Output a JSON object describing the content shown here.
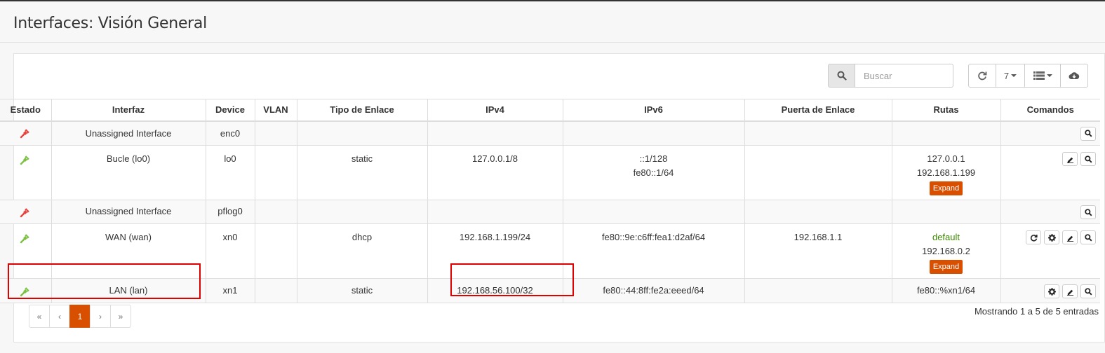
{
  "page": {
    "title": "Interfaces: Visión General"
  },
  "toolbar": {
    "search_placeholder": "Buscar",
    "refresh_icon": "refresh-icon",
    "page_size": "7",
    "columns_icon": "list-icon",
    "download_icon": "cloud-download-icon"
  },
  "table": {
    "headers": [
      "Estado",
      "Interfaz",
      "Device",
      "VLAN",
      "Tipo de Enlace",
      "IPv4",
      "IPv6",
      "Puerta de Enlace",
      "Rutas",
      "Comandos"
    ],
    "rows": [
      {
        "status": "down",
        "interface": "Unassigned Interface",
        "device": "enc0",
        "vlan": "",
        "link_type": "",
        "ipv4": "",
        "ipv6": [
          "",
          ""
        ],
        "gateway": "",
        "routes": [
          "",
          ""
        ],
        "expand": "",
        "commands": [
          "search"
        ]
      },
      {
        "status": "up",
        "interface": "Bucle (lo0)",
        "device": "lo0",
        "vlan": "",
        "link_type": "static",
        "ipv4": "127.0.0.1/8",
        "ipv6": [
          "::1/128",
          "fe80::1/64"
        ],
        "gateway": "",
        "routes": [
          "127.0.0.1",
          "192.168.1.199"
        ],
        "expand": "Expand",
        "commands": [
          "edit",
          "search"
        ]
      },
      {
        "status": "down",
        "interface": "Unassigned Interface",
        "device": "pflog0",
        "vlan": "",
        "link_type": "",
        "ipv4": "",
        "ipv6": [
          "",
          ""
        ],
        "gateway": "",
        "routes": [
          "",
          ""
        ],
        "expand": "",
        "commands": [
          "search"
        ]
      },
      {
        "status": "up",
        "interface": "WAN (wan)",
        "device": "xn0",
        "vlan": "",
        "link_type": "dhcp",
        "ipv4": "192.168.1.199/24",
        "ipv6": [
          "fe80::9e:c6ff:fea1:d2af/64",
          ""
        ],
        "gateway": "192.168.1.1",
        "routes": [
          "default",
          "192.168.0.2"
        ],
        "expand": "Expand",
        "commands": [
          "reload",
          "settings",
          "edit",
          "search"
        ]
      },
      {
        "status": "up",
        "interface": "LAN (lan)",
        "device": "xn1",
        "vlan": "",
        "link_type": "static",
        "ipv4": "192.168.56.100/32",
        "ipv6": [
          "fe80::44:8ff:fe2a:eeed/64",
          ""
        ],
        "gateway": "",
        "routes": [
          "fe80::%xn1/64",
          ""
        ],
        "expand": "",
        "commands": [
          "settings",
          "edit",
          "search"
        ]
      }
    ]
  },
  "pagination": {
    "first": "«",
    "prev": "‹",
    "current": "1",
    "next": "›",
    "last": "»"
  },
  "footer": {
    "info": "Mostrando 1 a 5 de 5 entradas"
  },
  "colors": {
    "accent": "#d94f00",
    "status_up": "#7ac142",
    "status_down": "#e8413c",
    "highlight": "#e00000",
    "default_route": "#3c8a00"
  }
}
